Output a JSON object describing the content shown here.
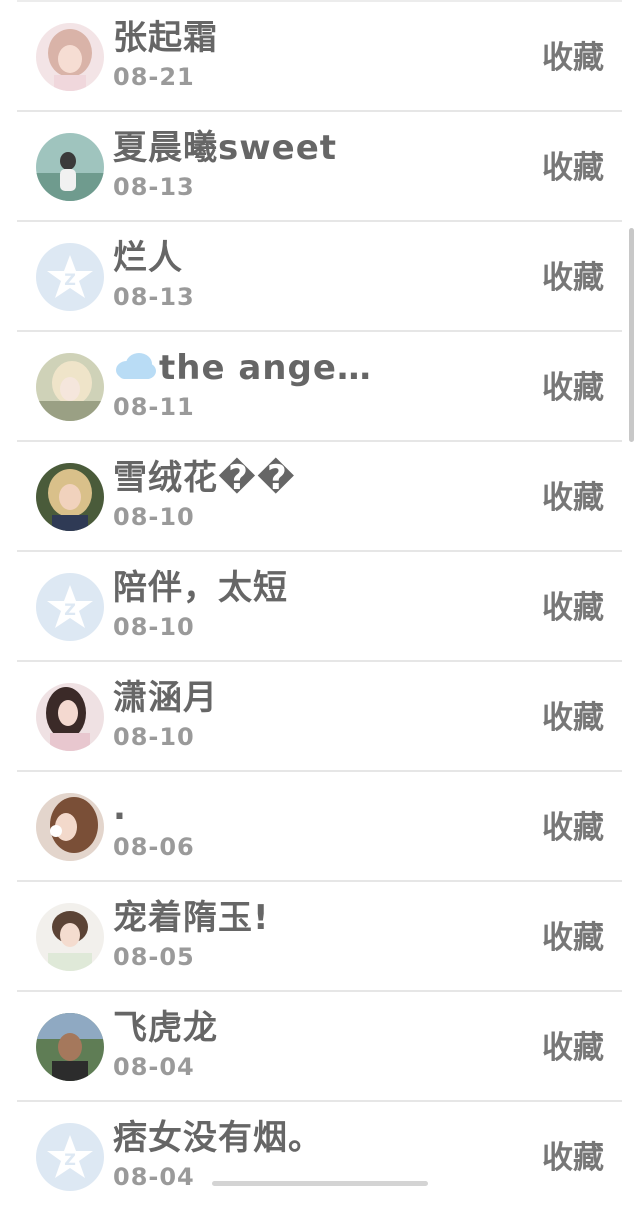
{
  "rows": [
    {
      "name": "张起霜",
      "date": "08-21",
      "action": "收藏",
      "avatar": "photo-pink-hair"
    },
    {
      "name": "夏晨曦sweet",
      "date": "08-13",
      "action": "收藏",
      "avatar": "photo-camera-girl"
    },
    {
      "name": "烂人",
      "date": "08-13",
      "action": "收藏",
      "avatar": "default-qq-avatar"
    },
    {
      "name": "the ange…",
      "date": "08-11",
      "action": "收藏",
      "avatar": "photo-angel",
      "prefix_icon": "cloud-icon"
    },
    {
      "name": "雪绒花��",
      "date": "08-10",
      "action": "收藏",
      "avatar": "photo-blonde"
    },
    {
      "name": "陪伴，太短",
      "date": "08-10",
      "action": "收藏",
      "avatar": "default-qq-avatar"
    },
    {
      "name": "潇涵月",
      "date": "08-10",
      "action": "收藏",
      "avatar": "photo-long-hair"
    },
    {
      "name": ".",
      "date": "08-06",
      "action": "收藏",
      "avatar": "photo-brown-hair"
    },
    {
      "name": "宠着隋玉!",
      "date": "08-05",
      "action": "收藏",
      "avatar": "photo-bangs"
    },
    {
      "name": "飞虎龙",
      "date": "08-04",
      "action": "收藏",
      "avatar": "photo-man"
    },
    {
      "name": "痞女没有烟。",
      "date": "08-04",
      "action": "收藏",
      "avatar": "default-qq-avatar"
    }
  ],
  "colors": {
    "name_text": "#666666",
    "date_text": "#9a9a9a",
    "action_text": "#777777",
    "divider": "#e6e6e6",
    "default_avatar_bg": "#dde8f3"
  }
}
